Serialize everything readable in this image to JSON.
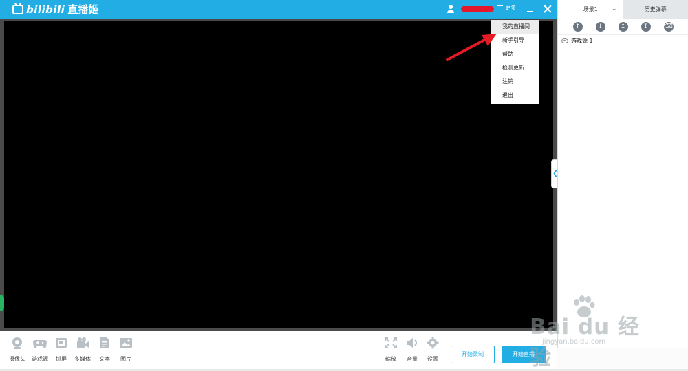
{
  "titlebar": {
    "brand": "bilibili",
    "app_name": "直播姬",
    "more_label": "更多"
  },
  "menu": {
    "items": [
      {
        "label": "我的直播间",
        "active": true
      },
      {
        "label": "新手引导"
      },
      {
        "label": "帮助"
      },
      {
        "label": "检测更新"
      },
      {
        "label": "注销"
      },
      {
        "label": "退出"
      }
    ]
  },
  "toolbar": {
    "sources": [
      {
        "label": "摄像头",
        "icon": "camera-icon"
      },
      {
        "label": "游戏源",
        "icon": "gamepad-icon"
      },
      {
        "label": "抓屏",
        "icon": "screen-capture-icon"
      },
      {
        "label": "多媒体",
        "icon": "video-camera-icon"
      },
      {
        "label": "文本",
        "icon": "text-document-icon"
      },
      {
        "label": "图片",
        "icon": "image-icon"
      }
    ],
    "controls": [
      {
        "label": "缩放",
        "icon": "zoom-fit-icon"
      },
      {
        "label": "音量",
        "icon": "volume-icon"
      },
      {
        "label": "设置",
        "icon": "gear-icon"
      }
    ],
    "record_label": "开始录制",
    "live_label": "开始直播"
  },
  "panel": {
    "tabs": [
      {
        "label": "场景1",
        "selected": true
      },
      {
        "label": "历史弹幕",
        "selected": false
      }
    ],
    "scene_tools": [
      "arrow-up-icon",
      "arrow-down-icon",
      "move-top-icon",
      "move-bottom-icon",
      "delete-icon"
    ],
    "sources": [
      {
        "name": "游戏源 1",
        "visible": true
      }
    ]
  },
  "watermark": {
    "main": "Bai du 经验",
    "sub": "jingyan.baidu.com"
  },
  "colors": {
    "accent": "#23ade5",
    "annotation_arrow": "#e41b23"
  }
}
